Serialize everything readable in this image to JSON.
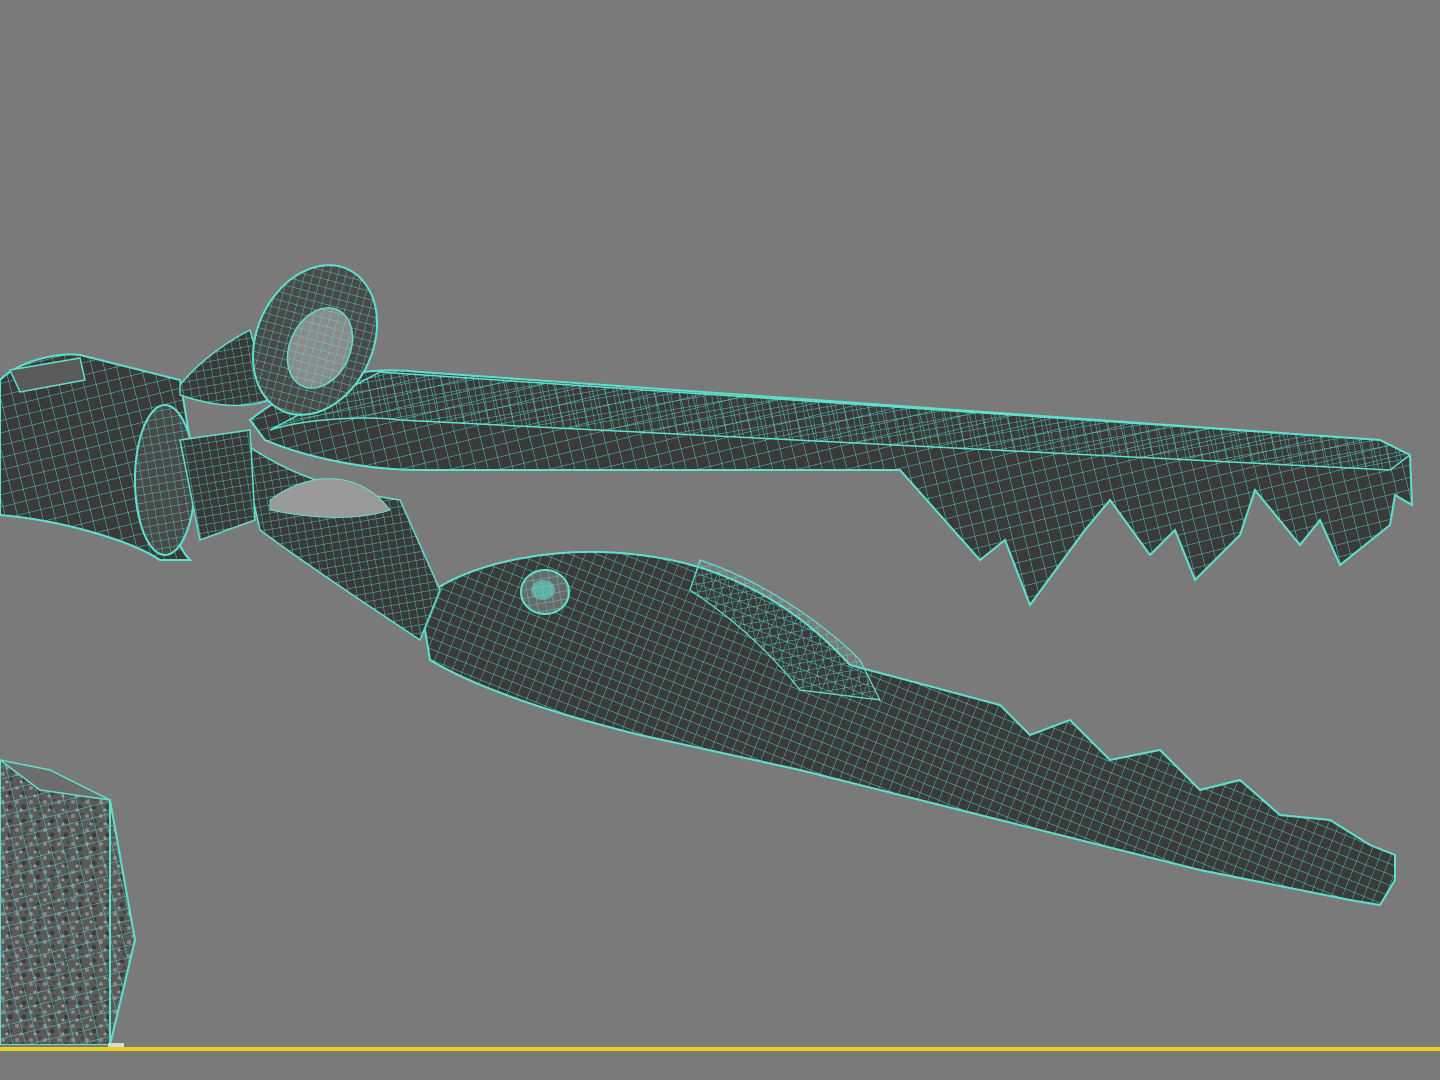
{
  "viewport": {
    "background_color": "#7a7a7a",
    "active_border_color": "#e8d31a"
  },
  "model": {
    "mesh_fill_color": "#3a3a3a",
    "wireframe_color": "#5fe0cf",
    "highlight_color": "#9a9a9a"
  },
  "icons": {
    "pivot_rivet": "rivet-icon",
    "hinge_ring": "ring-icon"
  }
}
